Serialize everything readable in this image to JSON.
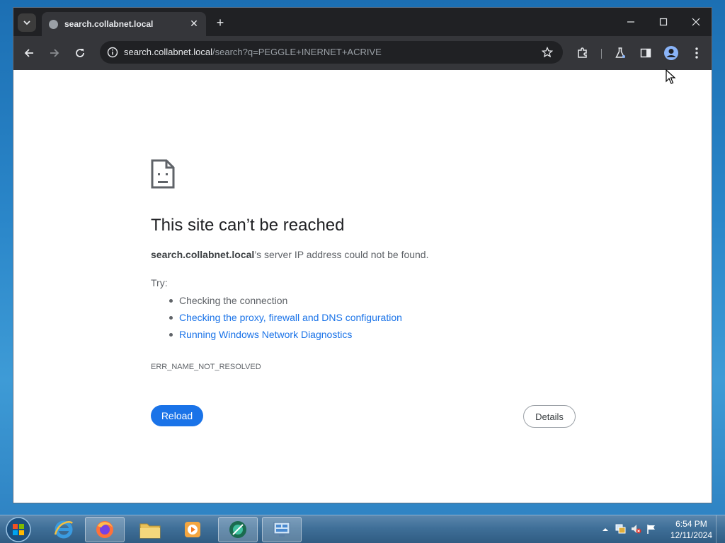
{
  "browser": {
    "tab": {
      "title": "search.collabnet.local",
      "close_glyph": "✕"
    },
    "new_tab_glyph": "+",
    "omnibox": {
      "host": "search.collabnet.local",
      "path": "/search?q=PEGGLE+INERNET+ACRIVE"
    }
  },
  "error_page": {
    "heading": "This site can’t be reached",
    "message_host": "search.collabnet.local",
    "message_rest": "’s server IP address could not be found.",
    "try_label": "Try:",
    "suggestions": {
      "checking_connection": "Checking the connection",
      "proxy_link": "Checking the proxy, firewall and DNS configuration",
      "diagnostics_link": "Running Windows Network Diagnostics"
    },
    "error_code": "ERR_NAME_NOT_RESOLVED",
    "reload_label": "Reload",
    "details_label": "Details"
  },
  "taskbar": {
    "time": "6:54 PM",
    "date": "12/11/2024"
  },
  "colors": {
    "accent": "#1a73e8",
    "chrome_dark": "#202124",
    "toolbar": "#35363a"
  }
}
